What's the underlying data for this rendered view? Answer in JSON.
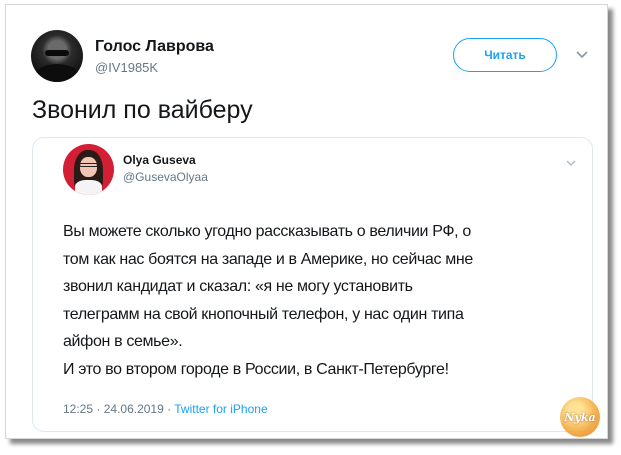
{
  "tweet": {
    "author_name": "Голос Лаврова",
    "author_handle": "@IV1985K",
    "follow_label": "Читать",
    "text": "Звонил по вайберу"
  },
  "quoted": {
    "author_name": "Olya Guseva",
    "author_handle": "@GusevaOlyaa",
    "lines": [
      "Вы можете сколько угодно рассказывать о величии РФ, о",
      "том как нас боятся на западе и в Америке, но сейчас мне",
      "звонил кандидат и сказал: «я не могу установить",
      "телеграмм на свой кнопочный телефон, у нас один типа",
      "айфон в семье».",
      "И это во втором городе в России, в Санкт-Петербурге!"
    ],
    "time": "12:25",
    "date": "24.06.2019",
    "source": "Twitter for iPhone"
  },
  "watermark": "Nyka",
  "colors": {
    "accent": "#1da1f2",
    "secondary_text": "#657786",
    "primary_text": "#14171a",
    "avatar_bg": "#d21f35"
  }
}
